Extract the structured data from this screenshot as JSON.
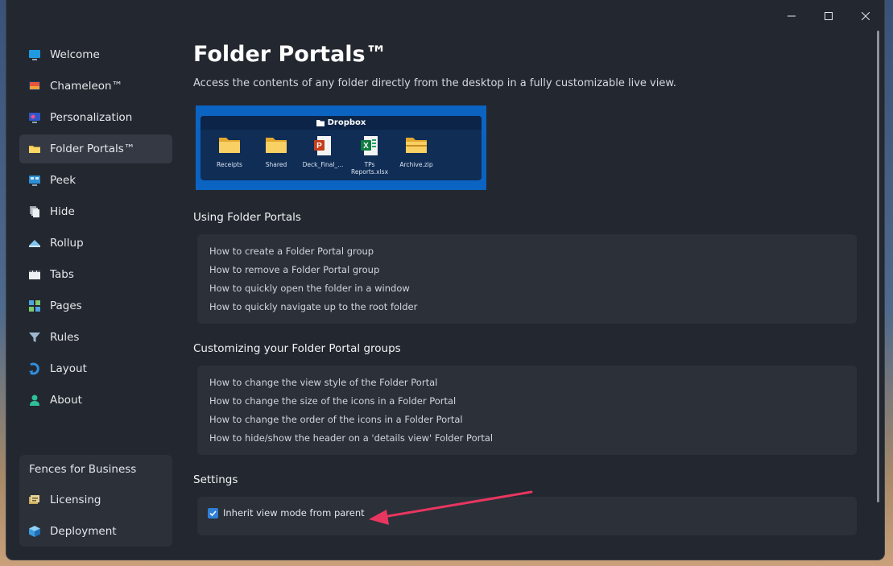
{
  "window": {
    "controls": [
      "minimize",
      "maximize",
      "close"
    ]
  },
  "sidebar": {
    "items": [
      {
        "label": "Welcome",
        "icon": "monitor-icon"
      },
      {
        "label": "Chameleon™",
        "icon": "chameleon-icon"
      },
      {
        "label": "Personalization",
        "icon": "personalization-icon"
      },
      {
        "label": "Folder Portals™",
        "icon": "folder-icon",
        "active": true
      },
      {
        "label": "Peek",
        "icon": "peek-icon"
      },
      {
        "label": "Hide",
        "icon": "hide-icon"
      },
      {
        "label": "Rollup",
        "icon": "rollup-icon"
      },
      {
        "label": "Tabs",
        "icon": "tabs-icon"
      },
      {
        "label": "Pages",
        "icon": "pages-icon"
      },
      {
        "label": "Rules",
        "icon": "filter-icon"
      },
      {
        "label": "Layout",
        "icon": "layout-icon"
      },
      {
        "label": "About",
        "icon": "person-icon"
      }
    ],
    "business": {
      "title": "Fences for Business",
      "items": [
        {
          "label": "Licensing",
          "icon": "license-icon"
        },
        {
          "label": "Deployment",
          "icon": "cube-icon"
        }
      ]
    }
  },
  "main": {
    "title": "Folder Portals™",
    "description": "Access the contents of any folder directly from the desktop in a fully customizable live view.",
    "preview": {
      "header": "Dropbox",
      "files": [
        {
          "name": "Receipts",
          "icon": "folder-icon"
        },
        {
          "name": "Shared",
          "icon": "folder-icon"
        },
        {
          "name": "Deck_Final_...",
          "icon": "powerpoint-icon"
        },
        {
          "name": "TPs Reports.xlsx",
          "icon": "excel-icon"
        },
        {
          "name": "Archive.zip",
          "icon": "zip-folder-icon"
        }
      ]
    },
    "using": {
      "title": "Using Folder Portals",
      "links": [
        "How to create a Folder Portal group",
        "How to remove a Folder Portal group",
        "How to quickly open the folder in a window",
        "How to quickly navigate up to the root folder"
      ]
    },
    "customizing": {
      "title": "Customizing your Folder Portal groups",
      "links": [
        "How to change the view style of the Folder Portal",
        "How to change the size of the icons in a Folder Portal",
        "How to change the order of the icons in a Folder Portal",
        "How to hide/show the header on a 'details view' Folder Portal"
      ]
    },
    "settings": {
      "title": "Settings",
      "inherit_label": "Inherit view mode from parent",
      "inherit_checked": true
    }
  },
  "colors": {
    "window_bg": "#23272f",
    "card_bg": "#2b3039",
    "accent": "#2f7fd6",
    "arrow": "#e8365f",
    "preview_bg": "#0b63c2"
  }
}
